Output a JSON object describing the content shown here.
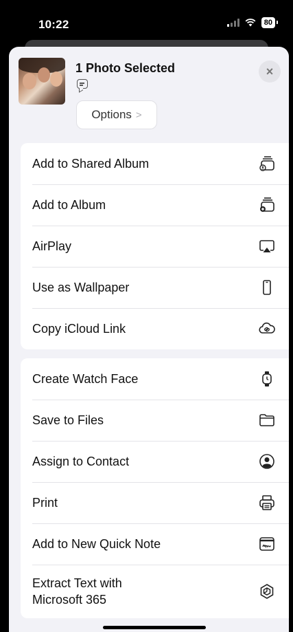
{
  "status_bar": {
    "time": "10:22",
    "battery": "80"
  },
  "share_sheet": {
    "title": "1 Photo Selected",
    "options_label": "Options",
    "options_chevron": ">",
    "close_label": "×"
  },
  "groups": [
    {
      "rows": [
        {
          "label": "Add to Shared Album",
          "icon": "shared-album-icon"
        },
        {
          "label": "Add to Album",
          "icon": "album-icon"
        },
        {
          "label": "AirPlay",
          "icon": "airplay-icon"
        },
        {
          "label": "Use as Wallpaper",
          "icon": "phone-icon"
        },
        {
          "label": "Copy iCloud Link",
          "icon": "icloud-link-icon"
        }
      ]
    },
    {
      "rows": [
        {
          "label": "Create Watch Face",
          "icon": "watch-icon"
        },
        {
          "label": "Save to Files",
          "icon": "folder-icon"
        },
        {
          "label": "Assign to Contact",
          "icon": "contact-icon"
        },
        {
          "label": "Print",
          "icon": "printer-icon"
        },
        {
          "label": "Add to New Quick Note",
          "icon": "quick-note-icon"
        },
        {
          "label": "Extract Text with\nMicrosoft 365",
          "icon": "microsoft-365-icon"
        }
      ]
    }
  ]
}
